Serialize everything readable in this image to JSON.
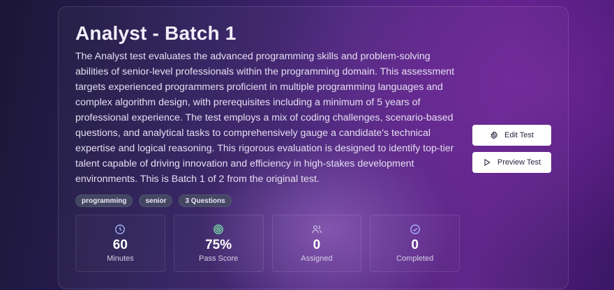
{
  "test": {
    "title": "Analyst - Batch 1",
    "description": "The Analyst test evaluates the advanced programming skills and problem-solving abilities of senior-level professionals within the programming domain. This assessment targets experienced programmers proficient in multiple programming languages and complex algorithm design, with prerequisites including a minimum of 5 years of professional experience. The test employs a mix of coding challenges, scenario-based questions, and analytical tasks to comprehensively gauge a candidate's technical expertise and logical reasoning. This rigorous evaluation is designed to identify top-tier talent capable of driving innovation and efficiency in high-stakes development environments. This is Batch 1 of 2 from the original test.",
    "tags": [
      "programming",
      "senior",
      "3 Questions"
    ]
  },
  "stats": [
    {
      "icon": "clock-icon",
      "value": "60",
      "label": "Minutes"
    },
    {
      "icon": "target-icon",
      "value": "75%",
      "label": "Pass Score"
    },
    {
      "icon": "users-icon",
      "value": "0",
      "label": "Assigned"
    },
    {
      "icon": "check-circle-icon",
      "value": "0",
      "label": "Completed"
    }
  ],
  "actions": {
    "edit_label": "Edit Test",
    "preview_label": "Preview Test"
  },
  "colors": {
    "icon_accent": "#a8b8ff",
    "target_accent": "#7de3a8"
  }
}
